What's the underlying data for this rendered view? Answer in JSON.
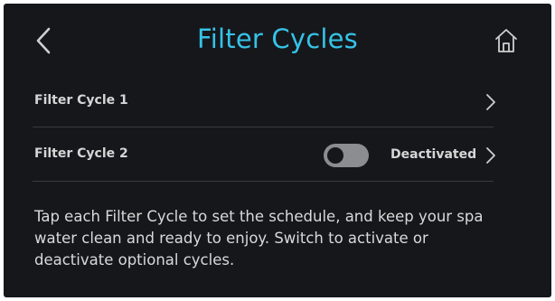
{
  "header": {
    "title": "Filter Cycles",
    "back_icon": "chevron-left-icon",
    "home_icon": "home-icon"
  },
  "rows": [
    {
      "label": "Filter Cycle 1",
      "chevron_icon": "chevron-right-icon"
    },
    {
      "label": "Filter Cycle 2",
      "toggle_on": false,
      "status": "Deactivated",
      "chevron_icon": "chevron-right-icon"
    }
  ],
  "description": "Tap each Filter Cycle to set the schedule, and keep your spa water clean and ready to enjoy. Switch to activate or deactivate optional cycles.",
  "colors": {
    "background": "#16171b",
    "title": "#35c3e7",
    "text": "#d6d6d6",
    "toggle_off": "#8c8d90",
    "divider": "#3a3b40"
  }
}
